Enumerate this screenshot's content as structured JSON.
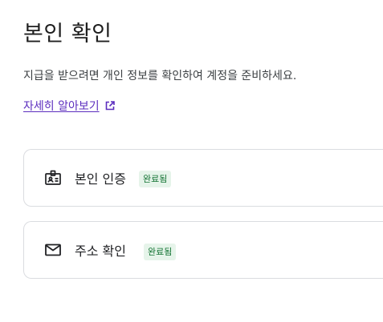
{
  "header": {
    "title": "본인 확인",
    "description": "지급을 받으려면 개인 정보를 확인하여 계정을 준비하세요.",
    "learn_more_label": "자세히 알아보기"
  },
  "cards": [
    {
      "label": "본인 인증",
      "status": "완료됨",
      "icon": "id-badge-icon"
    },
    {
      "label": "주소 확인",
      "status": "완료됨",
      "icon": "mail-icon"
    }
  ],
  "colors": {
    "link": "#5b2dbe",
    "badge_bg": "#e6f4ea",
    "badge_text": "#137333",
    "border": "#dadce0"
  }
}
